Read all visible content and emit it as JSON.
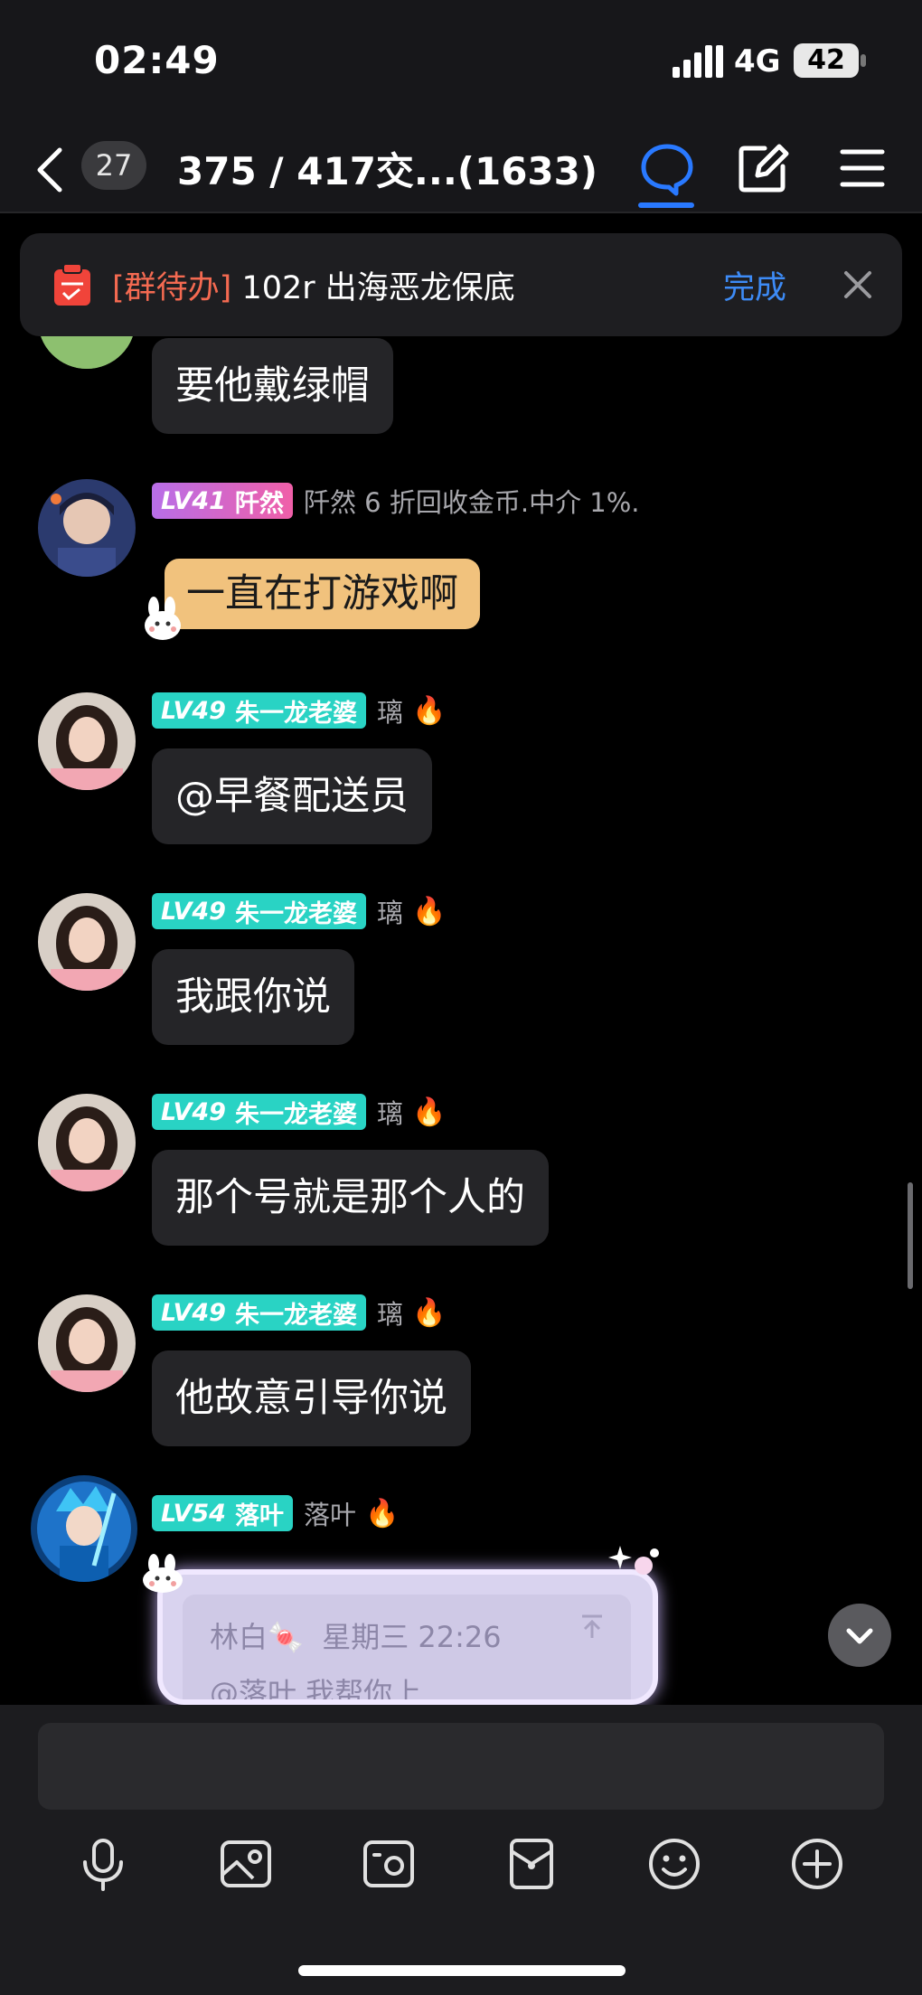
{
  "status_bar": {
    "time": "02:49",
    "network": "4G",
    "battery": "42"
  },
  "nav": {
    "unread_count": "27",
    "title": "375 / 417交...(1633)"
  },
  "todo_banner": {
    "tag": "[群待办]",
    "text": " 102r 出海恶龙保底",
    "done_label": "完成"
  },
  "messages": [
    {
      "text": "要他戴绿帽"
    },
    {
      "level": "LV41",
      "title_name": "阡然",
      "nickname": "阡然 6 折回收金币.中介 1%.",
      "text": "一直在打游戏啊"
    },
    {
      "level": "LV49",
      "title_name": "朱一龙老婆",
      "nickname": "璃",
      "text": "@早餐配送员"
    },
    {
      "level": "LV49",
      "title_name": "朱一龙老婆",
      "nickname": "璃",
      "text": "我跟你说"
    },
    {
      "level": "LV49",
      "title_name": "朱一龙老婆",
      "nickname": "璃",
      "text": "那个号就是那个人的"
    },
    {
      "level": "LV49",
      "title_name": "朱一龙老婆",
      "nickname": "璃",
      "text": "他故意引导你说"
    },
    {
      "level": "LV54",
      "title_name": "落叶",
      "nickname": "落叶",
      "quote": {
        "author": "林白🍬",
        "time": "星期三 22:26",
        "text": "@落叶 我帮你上"
      }
    }
  ],
  "input": {
    "placeholder": ""
  },
  "colors": {
    "accent": "#2979ff",
    "done": "#3d8bf6",
    "tag": "#f46a51",
    "lv_cyan": "#29d3c4",
    "lv_pink": "#d55ef0"
  },
  "icons": [
    "back-icon",
    "chat-bubble-icon",
    "edit-icon",
    "menu-icon",
    "clipboard-icon",
    "close-icon",
    "fire-icon",
    "chevron-down-icon",
    "microphone-icon",
    "image-icon",
    "camera-icon",
    "red-packet-icon",
    "emoji-icon",
    "plus-icon"
  ]
}
